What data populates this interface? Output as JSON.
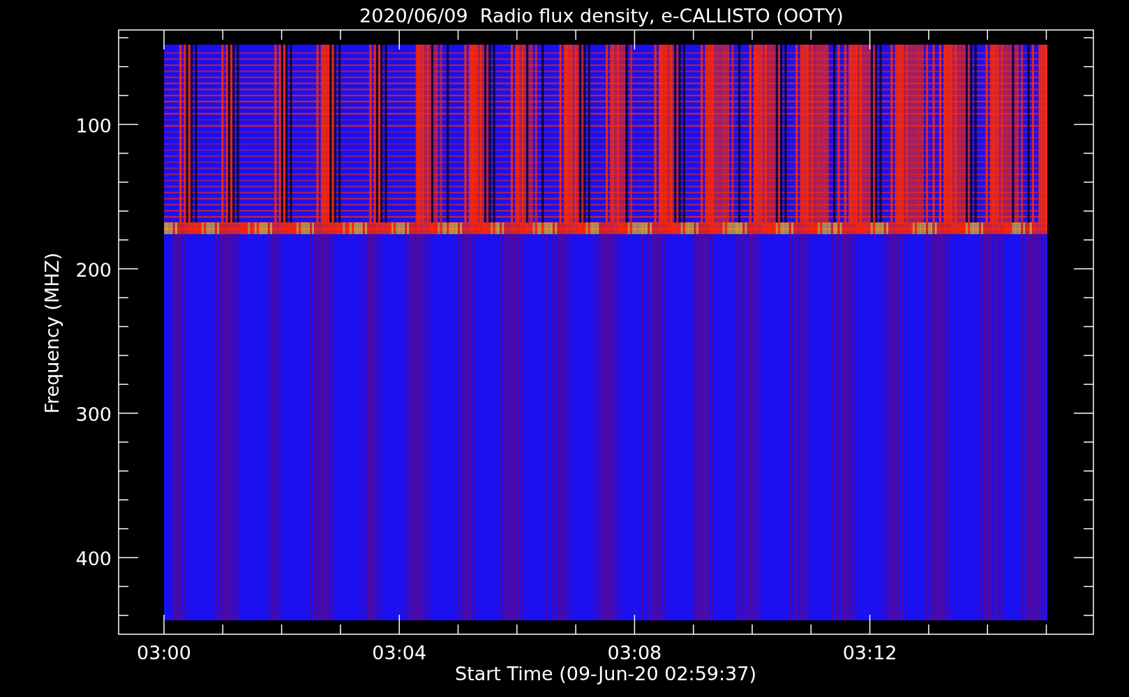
{
  "title": "2020/06/09  Radio flux density, e-CALLISTO (OOTY)",
  "y_axis": {
    "label": "Frequency (MHZ)",
    "ticks": [
      "100",
      "200",
      "300",
      "400"
    ]
  },
  "x_axis": {
    "label": "Start Time (09-Jun-20 02:59:37)",
    "ticks": [
      "03:00",
      "03:04",
      "03:08",
      "03:12"
    ]
  }
}
